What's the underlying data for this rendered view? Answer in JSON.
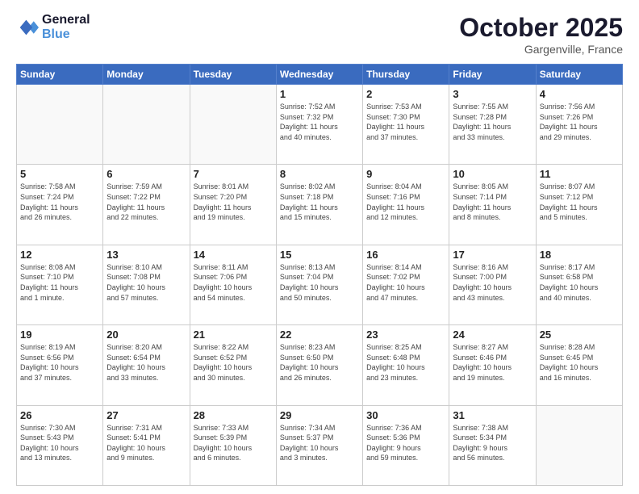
{
  "header": {
    "logo_line1": "General",
    "logo_line2": "Blue",
    "month": "October 2025",
    "location": "Gargenville, France"
  },
  "weekdays": [
    "Sunday",
    "Monday",
    "Tuesday",
    "Wednesday",
    "Thursday",
    "Friday",
    "Saturday"
  ],
  "weeks": [
    [
      {
        "day": "",
        "info": ""
      },
      {
        "day": "",
        "info": ""
      },
      {
        "day": "",
        "info": ""
      },
      {
        "day": "1",
        "info": "Sunrise: 7:52 AM\nSunset: 7:32 PM\nDaylight: 11 hours\nand 40 minutes."
      },
      {
        "day": "2",
        "info": "Sunrise: 7:53 AM\nSunset: 7:30 PM\nDaylight: 11 hours\nand 37 minutes."
      },
      {
        "day": "3",
        "info": "Sunrise: 7:55 AM\nSunset: 7:28 PM\nDaylight: 11 hours\nand 33 minutes."
      },
      {
        "day": "4",
        "info": "Sunrise: 7:56 AM\nSunset: 7:26 PM\nDaylight: 11 hours\nand 29 minutes."
      }
    ],
    [
      {
        "day": "5",
        "info": "Sunrise: 7:58 AM\nSunset: 7:24 PM\nDaylight: 11 hours\nand 26 minutes."
      },
      {
        "day": "6",
        "info": "Sunrise: 7:59 AM\nSunset: 7:22 PM\nDaylight: 11 hours\nand 22 minutes."
      },
      {
        "day": "7",
        "info": "Sunrise: 8:01 AM\nSunset: 7:20 PM\nDaylight: 11 hours\nand 19 minutes."
      },
      {
        "day": "8",
        "info": "Sunrise: 8:02 AM\nSunset: 7:18 PM\nDaylight: 11 hours\nand 15 minutes."
      },
      {
        "day": "9",
        "info": "Sunrise: 8:04 AM\nSunset: 7:16 PM\nDaylight: 11 hours\nand 12 minutes."
      },
      {
        "day": "10",
        "info": "Sunrise: 8:05 AM\nSunset: 7:14 PM\nDaylight: 11 hours\nand 8 minutes."
      },
      {
        "day": "11",
        "info": "Sunrise: 8:07 AM\nSunset: 7:12 PM\nDaylight: 11 hours\nand 5 minutes."
      }
    ],
    [
      {
        "day": "12",
        "info": "Sunrise: 8:08 AM\nSunset: 7:10 PM\nDaylight: 11 hours\nand 1 minute."
      },
      {
        "day": "13",
        "info": "Sunrise: 8:10 AM\nSunset: 7:08 PM\nDaylight: 10 hours\nand 57 minutes."
      },
      {
        "day": "14",
        "info": "Sunrise: 8:11 AM\nSunset: 7:06 PM\nDaylight: 10 hours\nand 54 minutes."
      },
      {
        "day": "15",
        "info": "Sunrise: 8:13 AM\nSunset: 7:04 PM\nDaylight: 10 hours\nand 50 minutes."
      },
      {
        "day": "16",
        "info": "Sunrise: 8:14 AM\nSunset: 7:02 PM\nDaylight: 10 hours\nand 47 minutes."
      },
      {
        "day": "17",
        "info": "Sunrise: 8:16 AM\nSunset: 7:00 PM\nDaylight: 10 hours\nand 43 minutes."
      },
      {
        "day": "18",
        "info": "Sunrise: 8:17 AM\nSunset: 6:58 PM\nDaylight: 10 hours\nand 40 minutes."
      }
    ],
    [
      {
        "day": "19",
        "info": "Sunrise: 8:19 AM\nSunset: 6:56 PM\nDaylight: 10 hours\nand 37 minutes."
      },
      {
        "day": "20",
        "info": "Sunrise: 8:20 AM\nSunset: 6:54 PM\nDaylight: 10 hours\nand 33 minutes."
      },
      {
        "day": "21",
        "info": "Sunrise: 8:22 AM\nSunset: 6:52 PM\nDaylight: 10 hours\nand 30 minutes."
      },
      {
        "day": "22",
        "info": "Sunrise: 8:23 AM\nSunset: 6:50 PM\nDaylight: 10 hours\nand 26 minutes."
      },
      {
        "day": "23",
        "info": "Sunrise: 8:25 AM\nSunset: 6:48 PM\nDaylight: 10 hours\nand 23 minutes."
      },
      {
        "day": "24",
        "info": "Sunrise: 8:27 AM\nSunset: 6:46 PM\nDaylight: 10 hours\nand 19 minutes."
      },
      {
        "day": "25",
        "info": "Sunrise: 8:28 AM\nSunset: 6:45 PM\nDaylight: 10 hours\nand 16 minutes."
      }
    ],
    [
      {
        "day": "26",
        "info": "Sunrise: 7:30 AM\nSunset: 5:43 PM\nDaylight: 10 hours\nand 13 minutes."
      },
      {
        "day": "27",
        "info": "Sunrise: 7:31 AM\nSunset: 5:41 PM\nDaylight: 10 hours\nand 9 minutes."
      },
      {
        "day": "28",
        "info": "Sunrise: 7:33 AM\nSunset: 5:39 PM\nDaylight: 10 hours\nand 6 minutes."
      },
      {
        "day": "29",
        "info": "Sunrise: 7:34 AM\nSunset: 5:37 PM\nDaylight: 10 hours\nand 3 minutes."
      },
      {
        "day": "30",
        "info": "Sunrise: 7:36 AM\nSunset: 5:36 PM\nDaylight: 9 hours\nand 59 minutes."
      },
      {
        "day": "31",
        "info": "Sunrise: 7:38 AM\nSunset: 5:34 PM\nDaylight: 9 hours\nand 56 minutes."
      },
      {
        "day": "",
        "info": ""
      }
    ]
  ]
}
